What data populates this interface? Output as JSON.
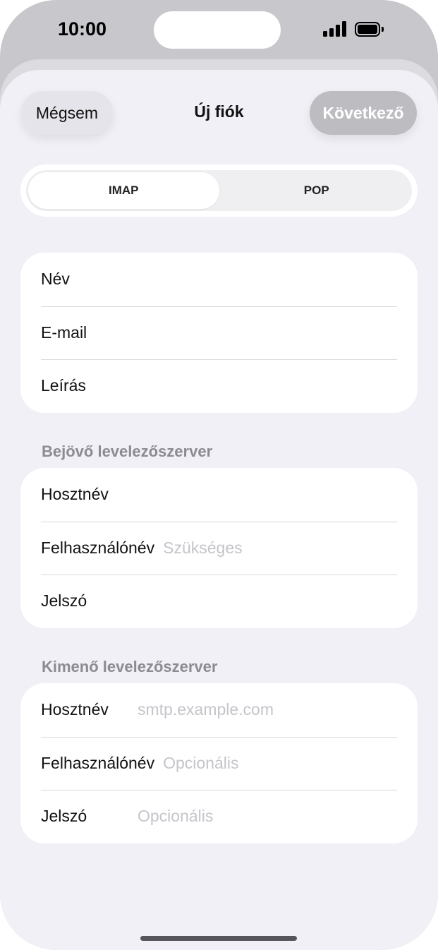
{
  "status_bar": {
    "time": "10:00"
  },
  "nav": {
    "cancel_label": "Mégsem",
    "title": "Új fiók",
    "next_label": "Következő"
  },
  "segmented": {
    "options": [
      "IMAP",
      "POP"
    ],
    "selected": "IMAP"
  },
  "account_fields": [
    {
      "label": "Név",
      "value": ""
    },
    {
      "label": "E-mail",
      "value": ""
    },
    {
      "label": "Leírás",
      "value": ""
    }
  ],
  "incoming": {
    "header": "Bejövő levelezőszerver",
    "fields": [
      {
        "label": "Hosztnév",
        "placeholder": ""
      },
      {
        "label": "Felhasználónév",
        "placeholder": "Szükséges"
      },
      {
        "label": "Jelszó",
        "placeholder": ""
      }
    ]
  },
  "outgoing": {
    "header": "Kimenő levelezőszerver",
    "fields": [
      {
        "label": "Hosztnév",
        "placeholder": "smtp.example.com"
      },
      {
        "label": "Felhasználónév",
        "placeholder": "Opcionális"
      },
      {
        "label": "Jelszó",
        "placeholder": "Opcionális"
      }
    ]
  },
  "colors": {
    "sheet_background": "#f1f0f6",
    "next_button_disabled": "#bdbcc1",
    "placeholder_text": "#c5c4ca",
    "section_header_text": "#8c8b91"
  }
}
